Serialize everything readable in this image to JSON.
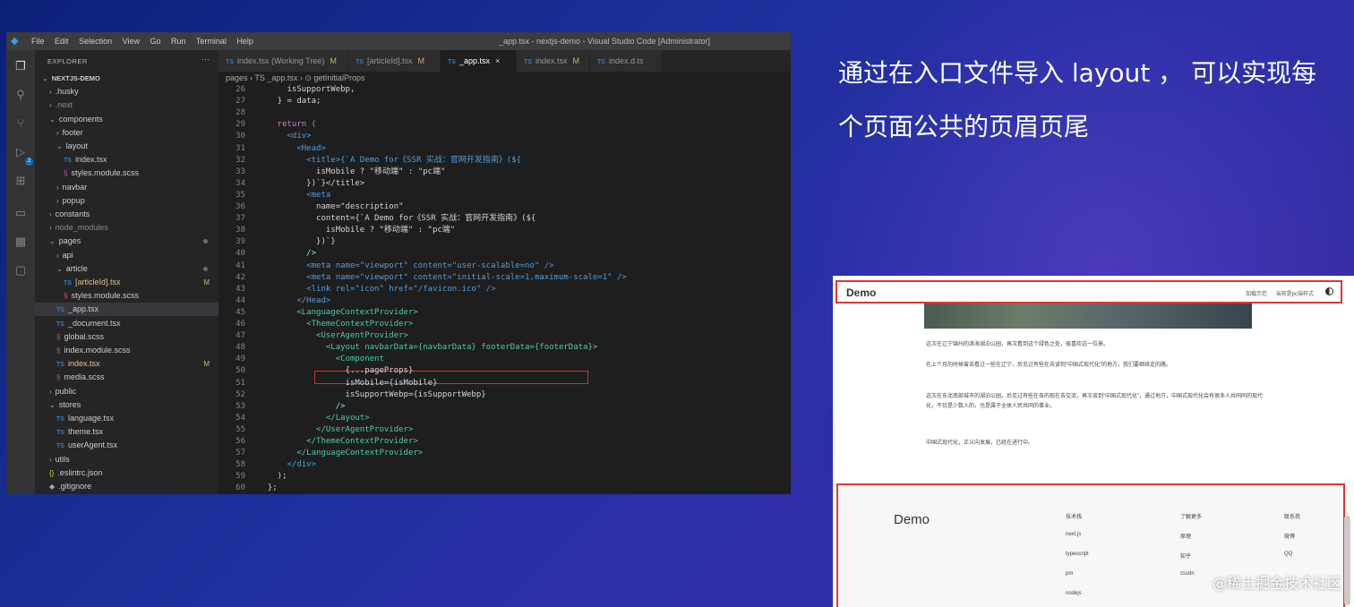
{
  "vscode": {
    "menu": [
      "File",
      "Edit",
      "Selection",
      "View",
      "Go",
      "Run",
      "Terminal",
      "Help"
    ],
    "window_title": "_app.tsx - nextjs-demo - Visual Studio Code [Administrator]",
    "explorer_label": "EXPLORER",
    "explorer_more": "···",
    "scm_badge": "2",
    "tree": [
      {
        "label": "NEXTJS-DEMO",
        "kind": "root"
      },
      {
        "label": ".husky",
        "kind": "folder"
      },
      {
        "label": ".next",
        "kind": "folder"
      },
      {
        "label": "components",
        "kind": "folder-open"
      },
      {
        "label": "footer",
        "kind": "folder"
      },
      {
        "label": "layout",
        "kind": "folder-open"
      },
      {
        "label": "index.tsx",
        "kind": "ts"
      },
      {
        "label": "styles.module.scss",
        "kind": "scss"
      },
      {
        "label": "navbar",
        "kind": "folder"
      },
      {
        "label": "popup",
        "kind": "folder"
      },
      {
        "label": "constants",
        "kind": "folder"
      },
      {
        "label": "node_modules",
        "kind": "folder"
      },
      {
        "label": "pages",
        "kind": "folder-open"
      },
      {
        "label": "api",
        "kind": "folder"
      },
      {
        "label": "article",
        "kind": "folder-open"
      },
      {
        "label": "[articleId].tsx",
        "kind": "ts"
      },
      {
        "label": "styles.module.scss",
        "kind": "scss"
      },
      {
        "label": "_app.tsx",
        "kind": "ts"
      },
      {
        "label": "_document.tsx",
        "kind": "ts"
      },
      {
        "label": "global.scss",
        "kind": "scss"
      },
      {
        "label": "index.module.scss",
        "kind": "scss"
      },
      {
        "label": "index.tsx",
        "kind": "ts"
      },
      {
        "label": "media.scss",
        "kind": "scss"
      },
      {
        "label": "public",
        "kind": "folder"
      },
      {
        "label": "stores",
        "kind": "folder-open"
      },
      {
        "label": "language.tsx",
        "kind": "ts"
      },
      {
        "label": "theme.tsx",
        "kind": "ts"
      },
      {
        "label": "userAgent.tsx",
        "kind": "ts"
      },
      {
        "label": "utils",
        "kind": "folder"
      },
      {
        "label": ".eslintrc.json",
        "kind": "json"
      },
      {
        "label": ".gitignore",
        "kind": "file"
      }
    ],
    "tabs": [
      {
        "label": "index.tsx (Working Tree)",
        "mark": "M"
      },
      {
        "label": "[articleId].tsx",
        "mark": "M"
      },
      {
        "label": "_app.tsx",
        "mark": "×"
      },
      {
        "label": "index.tsx",
        "mark": "M"
      },
      {
        "label": "index.d.ts",
        "mark": ""
      }
    ],
    "breadcrumb": "pages › TS _app.tsx › ⊙ getInitialProps",
    "code": [
      {
        "ln": "26",
        "text": "      isSupportWebp,"
      },
      {
        "ln": "27",
        "text": "    } = data;"
      },
      {
        "ln": "28",
        "text": ""
      },
      {
        "ln": "29",
        "text": "    return ("
      },
      {
        "ln": "30",
        "text": "      <div>"
      },
      {
        "ln": "31",
        "text": "        <Head>"
      },
      {
        "ln": "32",
        "text": "          <title>{`A Demo for《SSR 实战：官网开发指南》(${"
      },
      {
        "ln": "33",
        "text": "            isMobile ? \"移动端\" : \"pc端\""
      },
      {
        "ln": "34",
        "text": "          })`}</title>"
      },
      {
        "ln": "35",
        "text": "          <meta"
      },
      {
        "ln": "36",
        "text": "            name=\"description\""
      },
      {
        "ln": "37",
        "text": "            content={`A Demo for《SSR 实战：官网开发指南》(${"
      },
      {
        "ln": "38",
        "text": "              isMobile ? \"移动端\" : \"pc端\""
      },
      {
        "ln": "39",
        "text": "            })`}"
      },
      {
        "ln": "40",
        "text": "          />"
      },
      {
        "ln": "41",
        "text": "          <meta name=\"viewport\" content=\"user-scalable=no\" />"
      },
      {
        "ln": "42",
        "text": "          <meta name=\"viewport\" content=\"initial-scale=1,maximum-scale=1\" />"
      },
      {
        "ln": "43",
        "text": "          <link rel=\"icon\" href=\"/favicon.ico\" />"
      },
      {
        "ln": "44",
        "text": "        </Head>"
      },
      {
        "ln": "45",
        "text": "        <LanguageContextProvider>"
      },
      {
        "ln": "46",
        "text": "          <ThemeContextProvider>"
      },
      {
        "ln": "47",
        "text": "            <UserAgentProvider>"
      },
      {
        "ln": "48",
        "text": "              <Layout navbarData={navbarData} footerData={footerData}>"
      },
      {
        "ln": "49",
        "text": "                <Component"
      },
      {
        "ln": "50",
        "text": "                  {...pageProps}"
      },
      {
        "ln": "51",
        "text": "                  isMobile={isMobile}"
      },
      {
        "ln": "52",
        "text": "                  isSupportWebp={isSupportWebp}"
      },
      {
        "ln": "53",
        "text": "                />"
      },
      {
        "ln": "54",
        "text": "              </Layout>"
      },
      {
        "ln": "55",
        "text": "            </UserAgentProvider>"
      },
      {
        "ln": "56",
        "text": "          </ThemeContextProvider>"
      },
      {
        "ln": "57",
        "text": "        </LanguageContextProvider>"
      },
      {
        "ln": "58",
        "text": "      </div>"
      },
      {
        "ln": "59",
        "text": "    );"
      },
      {
        "ln": "60",
        "text": "  };"
      }
    ]
  },
  "headline": "通过在入口文件导入 layout ， 可以实现每个页面公共的页眉页尾",
  "preview": {
    "logo": "Demo",
    "nav": [
      "加载示范",
      "当前是pc端样式"
    ],
    "paragraphs": [
      "这次在辽宁锦州的滨海湖泊公园，再次看到这个绿色之处，很喜欢这一位景。",
      "在上个月的时候曾去看过一些在辽宁，后见过有些在去读到“中国式现代化”的地方，我们要继续走的路。",
      "这次在东北南部城市的湖泊公园，后见过有些在各的现在去交流，再次谈到“中国式现代化”，通过地方，中国式现代化会有很多人共同同的现代化，不仅是少数人的，也是属于全体人民共同的事业。",
      "中国式现代化，正义向发展，已经在进行中。"
    ],
    "footer_logo": "Demo",
    "footer_cols": [
      [
        "技术栈",
        "next.js",
        "typescript",
        "pm",
        "nodejs"
      ],
      [
        "了解更多",
        "原理",
        "知乎",
        "cssdn"
      ],
      [
        "联系我",
        "微博",
        "QQ"
      ]
    ]
  },
  "credit": "@稀土掘金技术社区"
}
